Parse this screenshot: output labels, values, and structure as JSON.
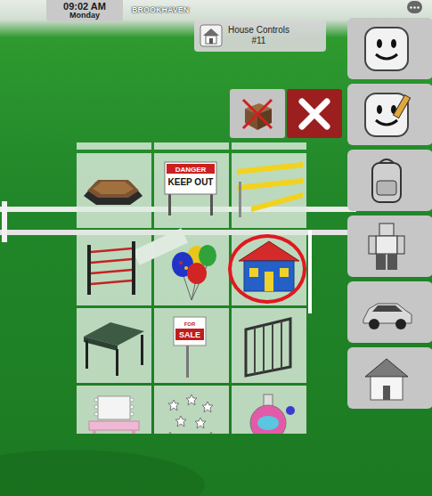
{
  "clock": {
    "time": "09:02 AM",
    "day": "Monday"
  },
  "game_title": "BROOKHAVEN",
  "house_controls": {
    "title": "House Controls",
    "number": "#11"
  },
  "actions": [
    {
      "kind": "tools-off"
    },
    {
      "kind": "close"
    }
  ],
  "sidebar": {
    "items": [
      {
        "kind": "avatar"
      },
      {
        "kind": "avatar-edit"
      },
      {
        "kind": "backpack"
      },
      {
        "kind": "character"
      },
      {
        "kind": "vehicle"
      },
      {
        "kind": "house"
      }
    ]
  },
  "catalog": {
    "items": [
      {
        "kind": "picnic-table",
        "texts": [],
        "circled": false
      },
      {
        "kind": "danger-sign",
        "texts": [
          "DANGER",
          "KEEP OUT"
        ],
        "circled": false
      },
      {
        "kind": "police-tape",
        "texts": [],
        "circled": false
      },
      {
        "kind": "rope-barrier",
        "texts": [],
        "circled": false
      },
      {
        "kind": "balloons",
        "texts": [],
        "circled": false
      },
      {
        "kind": "house",
        "texts": [],
        "circled": true
      },
      {
        "kind": "canopy",
        "texts": [],
        "circled": false
      },
      {
        "kind": "sale-sign",
        "texts": [
          "FOR",
          "SALE"
        ],
        "circled": false
      },
      {
        "kind": "railing",
        "texts": [],
        "circled": false
      },
      {
        "kind": "vanity",
        "texts": [],
        "circled": false
      },
      {
        "kind": "stars",
        "texts": [],
        "circled": false
      },
      {
        "kind": "potion",
        "texts": [],
        "circled": false
      }
    ]
  }
}
